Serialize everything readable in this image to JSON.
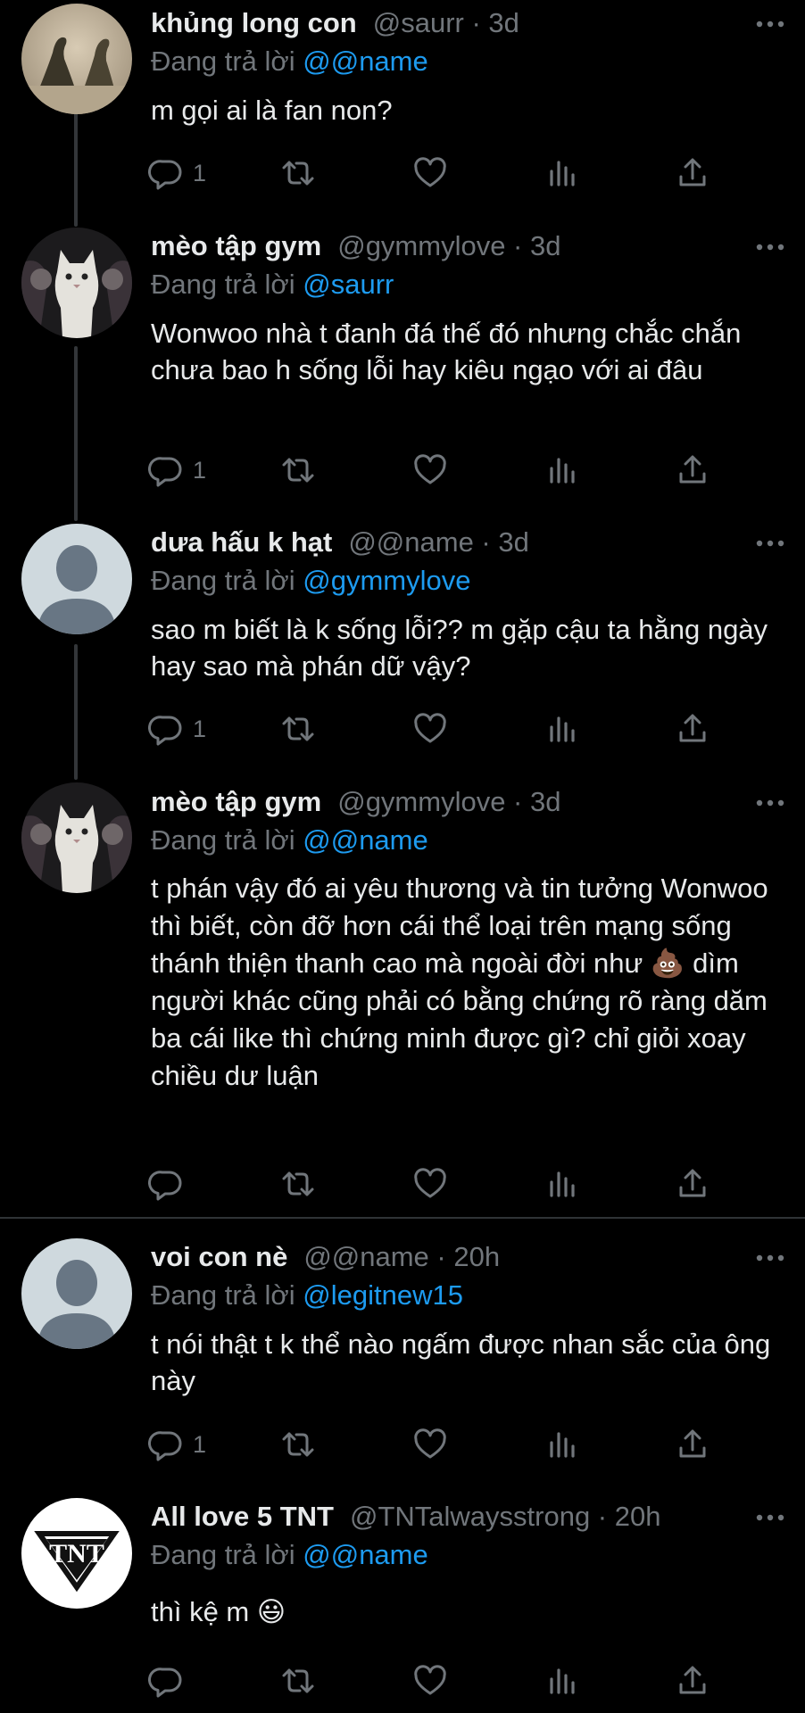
{
  "tweets": [
    {
      "display_name": "khủng long con",
      "handle_time": "@saurr · 3d",
      "replying_to_prefix": "Đang trả lời",
      "replying_to": "@@name",
      "text": "m gọi ai là fan non?",
      "reply_count": "1"
    },
    {
      "display_name": "mèo tập gym",
      "handle_time": "@gymmylove · 3d",
      "replying_to_prefix": "Đang trả lời",
      "replying_to": "@saurr",
      "text": "Wonwoo nhà t đanh đá thế đó nhưng chắc chắn chưa bao h sống lỗi hay kiêu ngạo với ai đâu",
      "reply_count": "1"
    },
    {
      "display_name": "dưa hấu k hạt",
      "handle_time": "@@name · 3d",
      "replying_to_prefix": "Đang trả lời",
      "replying_to": "@gymmylove",
      "text": "sao m biết là k sống lỗi?? m gặp cậu ta hằng ngày hay sao mà phán dữ vậy?",
      "reply_count": "1"
    },
    {
      "display_name": "mèo tập gym",
      "handle_time": "@gymmylove · 3d",
      "replying_to_prefix": "Đang trả lời",
      "replying_to": "@@name",
      "text_part1": "t phán vậy đó ai yêu thương và tin tưởng Wonwoo thì biết, còn đỡ hơn cái thể loại trên mạng sống thánh thiện thanh cao mà ngoài đời như ",
      "text_emoji": "💩",
      "text_part2": " dìm người khác cũng phải có bằng chứng rõ ràng dăm ba cái like thì chứng minh được gì? chỉ giỏi xoay chiều dư luận",
      "reply_count": ""
    },
    {
      "display_name": "voi con nè",
      "handle_time": "@@name · 20h",
      "replying_to_prefix": "Đang trả lời",
      "replying_to": "@legitnew15",
      "text": "t nói thật t k thể nào ngấm được nhan sắc của ông này",
      "reply_count": "1"
    },
    {
      "display_name": "All love 5 TNT",
      "handle_time": "@TNTalwaysstrong · 20h",
      "replying_to_prefix": "Đang trả lời",
      "replying_to": "@@name",
      "text": "thì kệ m ",
      "text_emoji": "😃",
      "reply_count": ""
    }
  ],
  "avatars": {
    "tweet_1": "dinosaur-avatar",
    "tweet_2": "cat-gym-avatar",
    "tweet_3": "default-avatar",
    "tweet_4": "cat-gym-avatar",
    "tweet_5": "default-avatar",
    "tweet_6": "tnt-logo-avatar",
    "tnt_logo_text": "TNT"
  },
  "colors": {
    "background": "#000000",
    "text": "#e7e9ea",
    "secondary": "#71767b",
    "mention": "#1d9bf0",
    "divider": "#2f3336"
  }
}
